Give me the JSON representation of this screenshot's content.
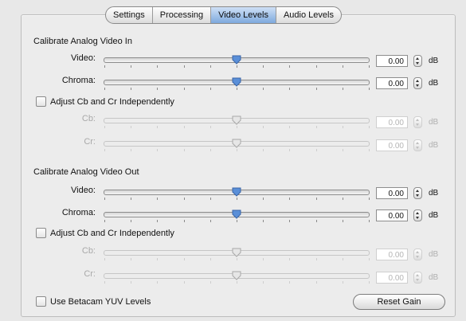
{
  "tabs": [
    {
      "label": "Settings",
      "active": false
    },
    {
      "label": "Processing",
      "active": false
    },
    {
      "label": "Video Levels",
      "active": true
    },
    {
      "label": "Audio Levels",
      "active": false
    }
  ],
  "analog_in": {
    "title": "Calibrate Analog Video In",
    "video": {
      "label": "Video:",
      "value": "0.00",
      "unit": "dB",
      "level": 0.5
    },
    "chroma": {
      "label": "Chroma:",
      "value": "0.00",
      "unit": "dB",
      "level": 0.5
    },
    "independent_checkbox": {
      "label": "Adjust Cb and Cr Independently",
      "checked": false
    },
    "cb": {
      "label": "Cb:",
      "value": "0.00",
      "unit": "dB",
      "level": 0.5,
      "enabled": false
    },
    "cr": {
      "label": "Cr:",
      "value": "0.00",
      "unit": "dB",
      "level": 0.5,
      "enabled": false
    }
  },
  "analog_out": {
    "title": "Calibrate Analog Video Out",
    "video": {
      "label": "Video:",
      "value": "0.00",
      "unit": "dB",
      "level": 0.5
    },
    "chroma": {
      "label": "Chroma:",
      "value": "0.00",
      "unit": "dB",
      "level": 0.5
    },
    "independent_checkbox": {
      "label": "Adjust Cb and Cr Independently",
      "checked": false
    },
    "cb": {
      "label": "Cb:",
      "value": "0.00",
      "unit": "dB",
      "level": 0.5,
      "enabled": false
    },
    "cr": {
      "label": "Cr:",
      "value": "0.00",
      "unit": "dB",
      "level": 0.5,
      "enabled": false
    }
  },
  "betacam_checkbox": {
    "label": "Use Betacam YUV Levels",
    "checked": false
  },
  "reset_button": {
    "label": "Reset Gain"
  },
  "colors": {
    "thumb_active": "#5a8fd8",
    "thumb_disabled": "#e6e6e6",
    "tab_active": "#8fb6e6"
  }
}
